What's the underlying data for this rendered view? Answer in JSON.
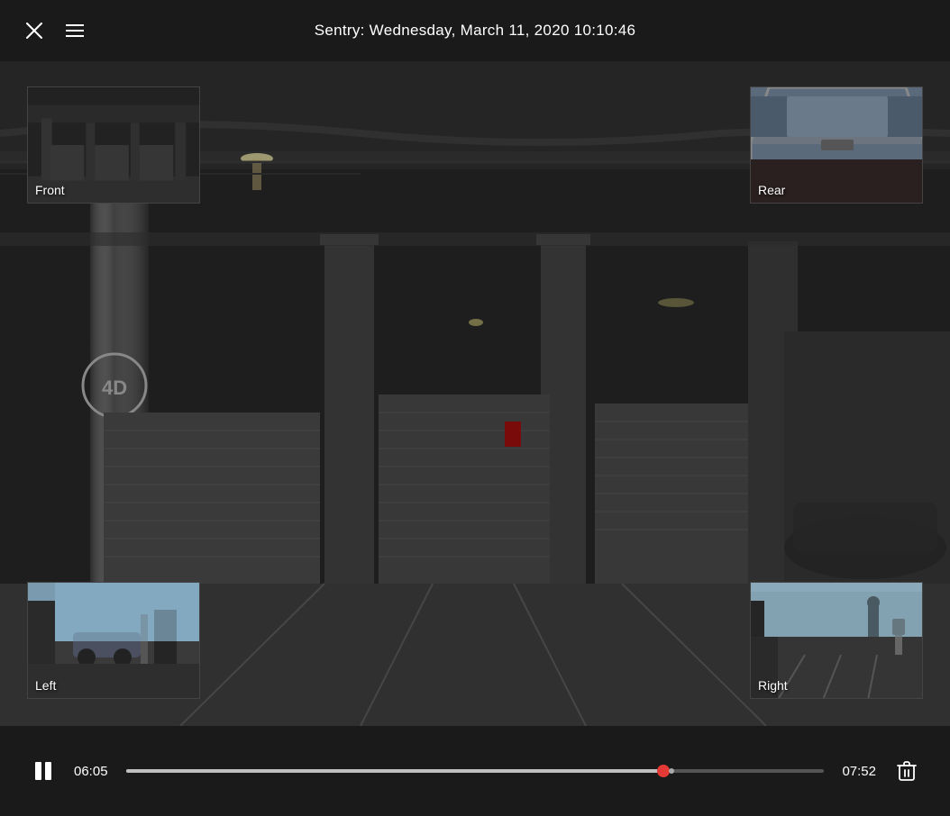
{
  "header": {
    "title": "Sentry: Wednesday, March 11, 2020 10:10:46",
    "close_label": "✕",
    "menu_label": "☰"
  },
  "cameras": {
    "front_label": "Front",
    "rear_label": "Rear",
    "left_label": "Left",
    "right_label": "Right"
  },
  "controls": {
    "pause_icon": "⏸",
    "time_current": "06:05",
    "time_total": "07:52",
    "progress_percent": 77,
    "delete_icon": "🗑"
  },
  "icons": {
    "close": "✕",
    "menu": "≡",
    "pause": "⏸",
    "delete": "trash"
  }
}
